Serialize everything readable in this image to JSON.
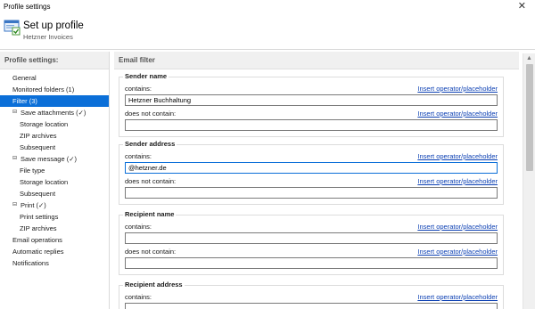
{
  "window": {
    "title": "Profile settings",
    "close_glyph": "✕"
  },
  "header": {
    "title": "Set up profile",
    "subtitle": "Hetzner Invoices",
    "icon": "profile-settings-icon"
  },
  "sidebar": {
    "heading": "Profile settings:",
    "items": [
      {
        "label": "General",
        "level": 0
      },
      {
        "label": "Monitored folders (1)",
        "level": 0
      },
      {
        "label": "Filter (3)",
        "level": 0,
        "selected": true
      },
      {
        "label": "Save attachments (✓)",
        "level": 0,
        "expander": "⊟"
      },
      {
        "label": "Storage location",
        "level": 1
      },
      {
        "label": "ZIP archives",
        "level": 1
      },
      {
        "label": "Subsequent",
        "level": 1
      },
      {
        "label": "Save message (✓)",
        "level": 0,
        "expander": "⊟"
      },
      {
        "label": "File type",
        "level": 1
      },
      {
        "label": "Storage location",
        "level": 1
      },
      {
        "label": "Subsequent",
        "level": 1
      },
      {
        "label": "Print  (✓)",
        "level": 0,
        "expander": "⊟"
      },
      {
        "label": "Print settings",
        "level": 1
      },
      {
        "label": "ZIP archives",
        "level": 1
      },
      {
        "label": "Email operations",
        "level": 0
      },
      {
        "label": "Automatic replies",
        "level": 0
      },
      {
        "label": "Notifications",
        "level": 0
      }
    ]
  },
  "main": {
    "heading": "Email filter",
    "link_label": "Insert operator/placeholder",
    "groups": [
      {
        "title": "Sender name",
        "contains_label": "contains:",
        "contains_value": "Hetzner Buchhaltung",
        "not_label": "does not contain:",
        "not_value": ""
      },
      {
        "title": "Sender address",
        "contains_label": "contains:",
        "contains_value": "@hetzner.de",
        "not_label": "does not contain:",
        "not_value": ""
      },
      {
        "title": "Recipient name",
        "contains_label": "contains:",
        "contains_value": "",
        "not_label": "does not contain:",
        "not_value": ""
      },
      {
        "title": "Recipient address",
        "contains_label": "contains:",
        "contains_value": ""
      }
    ]
  },
  "colors": {
    "selection": "#0b6fd8",
    "link": "#0b3fb3",
    "panel_header": "#f0f0f0"
  }
}
